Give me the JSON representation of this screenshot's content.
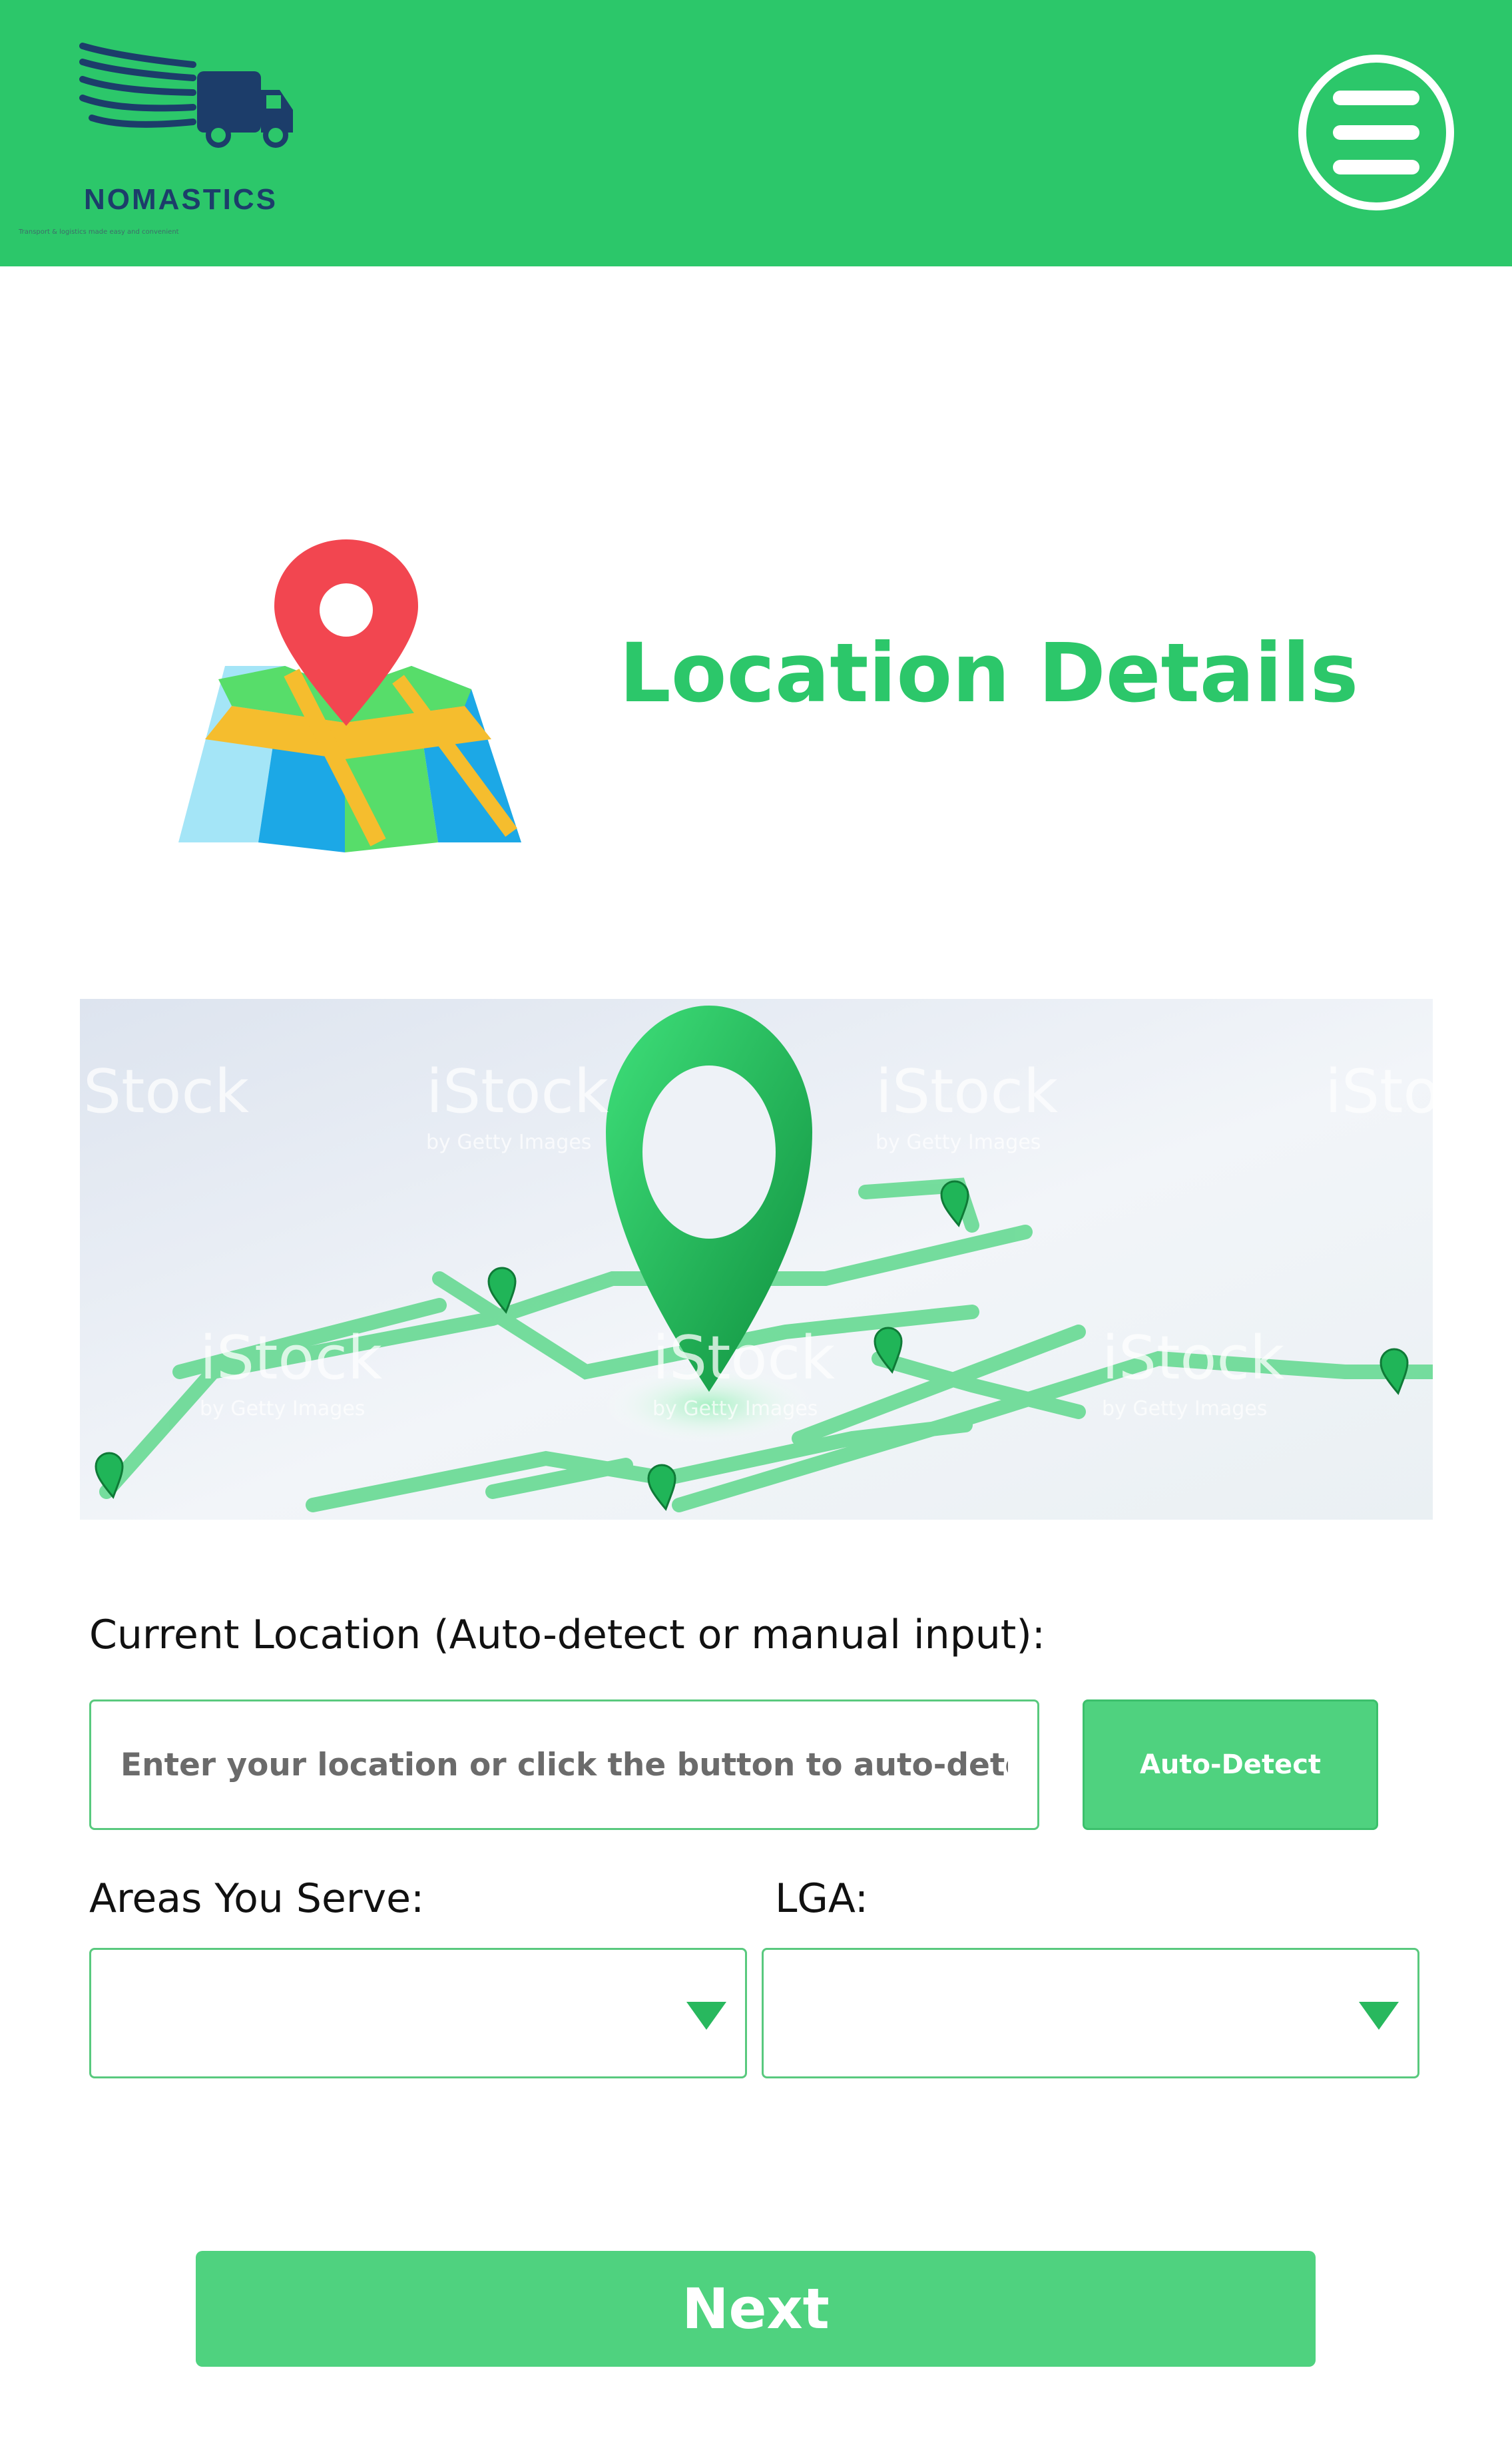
{
  "header": {
    "logo_name": "NOMASTICS",
    "logo_tagline": "Transport & logistics made easy and convenient",
    "menu_icon": "hamburger-menu-icon",
    "background_color": "#2cc76a"
  },
  "title_section": {
    "icon": "folded-map-pin-icon",
    "title": "Location Details",
    "title_color": "#2cc76a"
  },
  "hero_image": {
    "description_icon": "map-route-pin-illustration",
    "watermark_text": "iStock",
    "watermark_sub": "by Getty Images"
  },
  "form": {
    "current_location": {
      "label": "Current Location (Auto-detect or manual input):",
      "value": "",
      "placeholder": "Enter your location or click the button to auto-detect"
    },
    "auto_detect_label": "Auto-Detect",
    "areas_served": {
      "label": "Areas You Serve:",
      "selected": ""
    },
    "lga": {
      "label": "LGA:",
      "selected": ""
    },
    "next_label": "Next",
    "accent_color": "#4fd27f"
  }
}
